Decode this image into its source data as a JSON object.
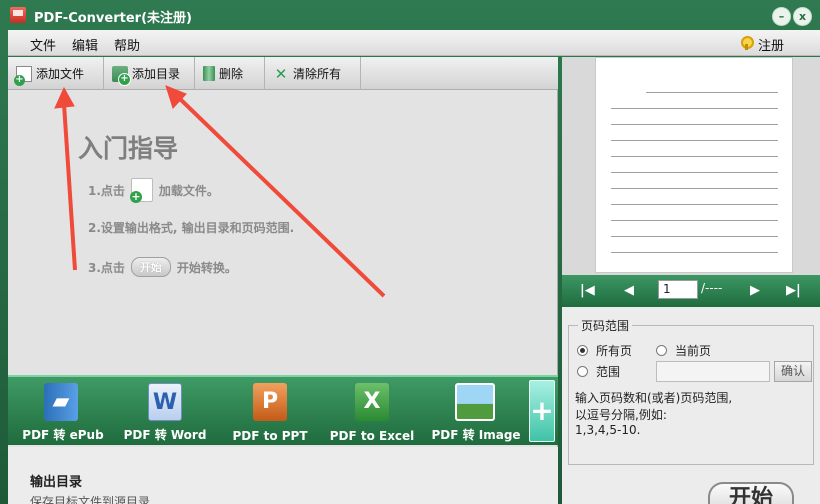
{
  "window": {
    "title": "PDF-Converter(未注册)",
    "minimize_glyph": "–",
    "close_glyph": "x"
  },
  "menu": {
    "items": [
      "文件",
      "编辑",
      "帮助"
    ],
    "register": "注册"
  },
  "toolbar": {
    "add_file": "添加文件",
    "add_folder": "添加目录",
    "delete": "删除",
    "clear_all": "清除所有"
  },
  "guide": {
    "title": "入门指导",
    "step1_a": "1.点击",
    "step1_b": "加载文件。",
    "step2": "2.设置输出格式, 输出目录和页码范围.",
    "step3_a": "3.点击",
    "step3_btn": "开始",
    "step3_b": "开始转换。"
  },
  "converters": [
    {
      "label": "PDF 转 ePub",
      "icon": "epub-book-icon"
    },
    {
      "label": "PDF 转 Word",
      "icon": "word-icon"
    },
    {
      "label": "PDF to PPT",
      "icon": "powerpoint-icon"
    },
    {
      "label": "PDF to Excel",
      "icon": "excel-icon"
    },
    {
      "label": "PDF 转 Image",
      "icon": "image-icon"
    }
  ],
  "add_converter_glyph": "+",
  "output": {
    "title": "输出目录",
    "option": "保存目标文件到源目录"
  },
  "start_button": "开始",
  "preview_nav": {
    "first": "|◀",
    "prev": "◀",
    "page_value": "1",
    "page_of": "/----",
    "next": "▶",
    "last": "▶|"
  },
  "page_range": {
    "legend": "页码范围",
    "all_pages": "所有页",
    "current_page": "当前页",
    "range": "范围",
    "confirm": "确认",
    "hint1": "输入页码数和(或者)页码范围,",
    "hint2": "以逗号分隔,例如:",
    "hint3": "1,3,4,5-10."
  },
  "colors": {
    "accent_green": "#2a6a45",
    "annotation_red": "#f04a3a"
  }
}
